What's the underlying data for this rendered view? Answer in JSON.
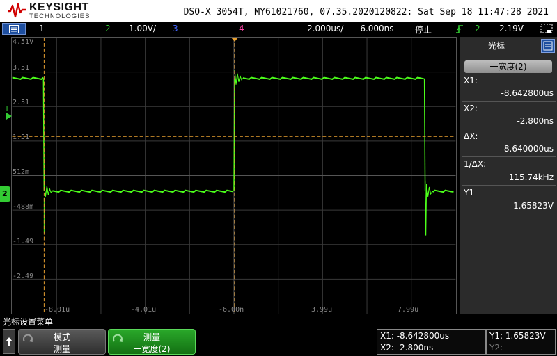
{
  "header": {
    "brand": "KEYSIGHT",
    "brand_sub": "TECHNOLOGIES",
    "title": "DSO-X 3054T, MY61021760, 07.35.2020120822: Sat Sep 18 11:47:28 2021"
  },
  "status": {
    "ch1": "1",
    "ch2": "2",
    "ch2_scale": "1.00V/",
    "ch3": "3",
    "ch4": "4",
    "timebase": "2.000us/",
    "delay": "-6.000ns",
    "run_state": "停止",
    "trig_source": "2",
    "trig_level": "2.19V"
  },
  "grid": {
    "y_labels": [
      "4.51V",
      "3.51",
      "2.51",
      "1.51",
      "512m",
      "-488m",
      "-1.49",
      "-2.49"
    ],
    "x_labels": [
      "-8.01u",
      "-4.01u",
      "-6.00n",
      "3.99u",
      "7.99u"
    ],
    "trigger_marker": "T",
    "channel_marker": "2"
  },
  "side_panel": {
    "title": "光标",
    "mode_button": "一宽度(2)",
    "x1_label": "X1:",
    "x1_value": "-8.642800us",
    "x2_label": "X2:",
    "x2_value": "-2.800ns",
    "dx_label": "ΔX:",
    "dx_value": "8.640000us",
    "inv_dx_label": "1/ΔX:",
    "inv_dx_value": "115.74kHz",
    "y1_label": "Y1",
    "y1_value": "1.65823V"
  },
  "softkeys": {
    "menu_title": "光标设置菜单",
    "mode_line1": "模式",
    "mode_line2": "测量",
    "measure_line1": "测量",
    "measure_line2": "一宽度(2)"
  },
  "readout": {
    "x1": "X1: -8.642800us",
    "x2": "X2: -2.800ns",
    "y1": "Y1: 1.65823V",
    "y2": "Y2: - - -"
  },
  "colors": {
    "trace": "#4cff1a",
    "ch2": "#33cc33",
    "ch3": "#4466ff",
    "ch4": "#ff44aa",
    "cursor": "#e8a030",
    "brand_red": "#d00000"
  }
}
